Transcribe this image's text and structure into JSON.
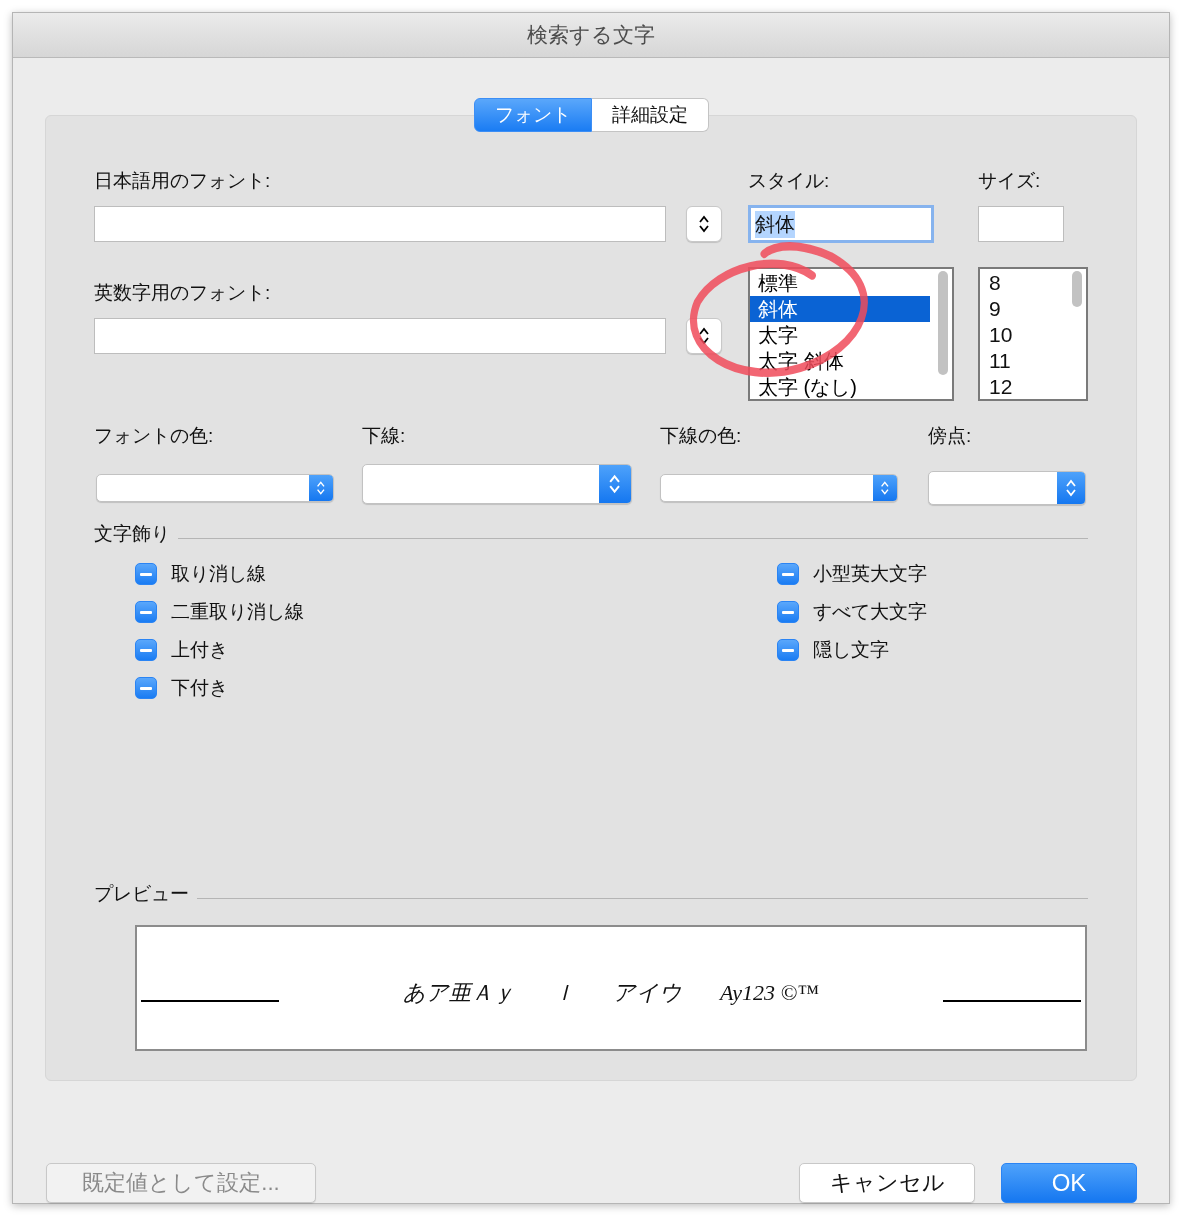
{
  "window": {
    "title": "検索する文字"
  },
  "tabs": [
    {
      "label": "フォント",
      "selected": true
    },
    {
      "label": "詳細設定",
      "selected": false
    }
  ],
  "japanese_font": {
    "label": "日本語用のフォント:"
  },
  "latin_font": {
    "label": "英数字用のフォント:"
  },
  "style": {
    "label": "スタイル:",
    "value": "斜体",
    "items": [
      {
        "label": "標準",
        "selected": false
      },
      {
        "label": "斜体",
        "selected": true
      },
      {
        "label": "太字",
        "selected": false
      },
      {
        "label": "太字 斜体",
        "selected": false
      },
      {
        "label": "太字 (なし)",
        "selected": false
      }
    ]
  },
  "size": {
    "label": "サイズ:",
    "items": [
      "8",
      "9",
      "10",
      "11",
      "12"
    ]
  },
  "popups": [
    {
      "label": "フォントの色:",
      "kind": "small"
    },
    {
      "label": "下線:",
      "kind": "large"
    },
    {
      "label": "下線の色:",
      "kind": "small"
    },
    {
      "label": "傍点:",
      "kind": "medium"
    }
  ],
  "effects": {
    "title": "文字飾り",
    "left": [
      {
        "label": "取り消し線",
        "mixed": true
      },
      {
        "label": "二重取り消し線",
        "mixed": true
      },
      {
        "label": "上付き",
        "mixed": true
      },
      {
        "label": "下付き",
        "mixed": true
      }
    ],
    "right": [
      {
        "label": "小型英大文字",
        "mixed": true
      },
      {
        "label": "すべて大文字",
        "mixed": true
      },
      {
        "label": "隠し文字",
        "mixed": true
      }
    ]
  },
  "preview": {
    "title": "プレビュー",
    "samples": [
      "あア亜Ａｙ",
      "ｌ",
      "アイウ",
      "Ay123 ©™"
    ]
  },
  "buttons": {
    "default": {
      "label": "既定値として設定...",
      "disabled": true
    },
    "cancel": "キャンセル",
    "ok": "OK"
  }
}
